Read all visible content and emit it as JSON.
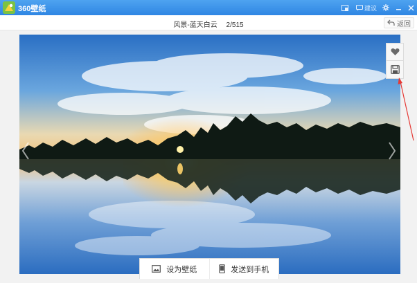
{
  "app": {
    "title": "360壁纸"
  },
  "titlebar": {
    "feedback_label": "建议"
  },
  "infobar": {
    "category": "风景-蓝天白云",
    "counter": "2/515",
    "back_label": "返回"
  },
  "actions": {
    "set_wallpaper": "设为壁纸",
    "send_to_phone": "发送到手机"
  },
  "colors": {
    "titlebar": "#2f86e3",
    "annotation_arrow": "#e53935"
  }
}
